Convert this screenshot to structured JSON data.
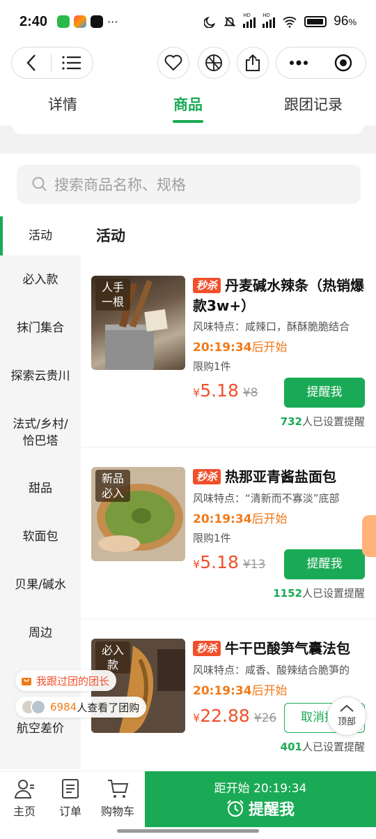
{
  "status_bar": {
    "time": "2:40",
    "more": "···",
    "battery": "96",
    "battery_unit": "%",
    "signal_label_1": "HD",
    "signal_label_2": "HD"
  },
  "tabs": [
    {
      "label": "详情"
    },
    {
      "label": "商品"
    },
    {
      "label": "跟团记录"
    }
  ],
  "search": {
    "placeholder": "搜索商品名称、规格"
  },
  "sidebar": {
    "items": [
      {
        "label": "活动"
      },
      {
        "label": "必入款"
      },
      {
        "label": "抹门集合"
      },
      {
        "label": "探索云贵川"
      },
      {
        "label": "法式/乡村/恰巴塔"
      },
      {
        "label": "甜品"
      },
      {
        "label": "软面包"
      },
      {
        "label": "贝果/碱水"
      },
      {
        "label": "周边"
      },
      {
        "label": "航空差价"
      }
    ]
  },
  "section_title": "活动",
  "products": [
    {
      "image_tag": "人手一根",
      "badge": "秒杀",
      "title": "丹麦碱水辣条（热销爆款3w+）",
      "feature": "风味特点：咸辣口，酥酥脆脆结合",
      "countdown": "20:19:34",
      "countdown_suffix": "后开始",
      "limit": "限购1件",
      "currency": "¥",
      "price": "5.18",
      "original_price": "¥8",
      "button": "提醒我",
      "reminder_count": "732",
      "reminder_suffix": "人已设置提醒"
    },
    {
      "image_tag": "新品必入",
      "badge": "秒杀",
      "title": "热那亚青酱盐面包",
      "feature": "风味特点：“清新而不寡淡”底部",
      "countdown": "20:19:34",
      "countdown_suffix": "后开始",
      "limit": "限购1件",
      "currency": "¥",
      "price": "5.18",
      "original_price": "¥13",
      "button": "提醒我",
      "reminder_count": "1152",
      "reminder_suffix": "人已设置提醒"
    },
    {
      "image_tag": "必入款",
      "badge": "秒杀",
      "title": "牛干巴酸笋气囊法包",
      "feature": "风味特点：咸香、酸辣结合脆笋的",
      "countdown": "20:19:34",
      "countdown_suffix": "后开始",
      "currency": "¥",
      "price": "22.88",
      "original_price": "¥26",
      "button": "取消提醒",
      "reminder_count": "401",
      "reminder_suffix": "人已设置提醒"
    }
  ],
  "overlays": {
    "joined_leader": "我跟过团的团长",
    "viewers_count": "6984",
    "viewers_suffix": "人查看了团购",
    "top_button": "顶部"
  },
  "bottom_bar": {
    "home": "主页",
    "orders": "订单",
    "cart": "购物车",
    "cta_line1": "距开始 20:19:34",
    "cta_line2": "提醒我"
  },
  "colors": {
    "accent": "#1aaa55",
    "sale": "#f0502c",
    "countdown": "#f07a1a"
  }
}
